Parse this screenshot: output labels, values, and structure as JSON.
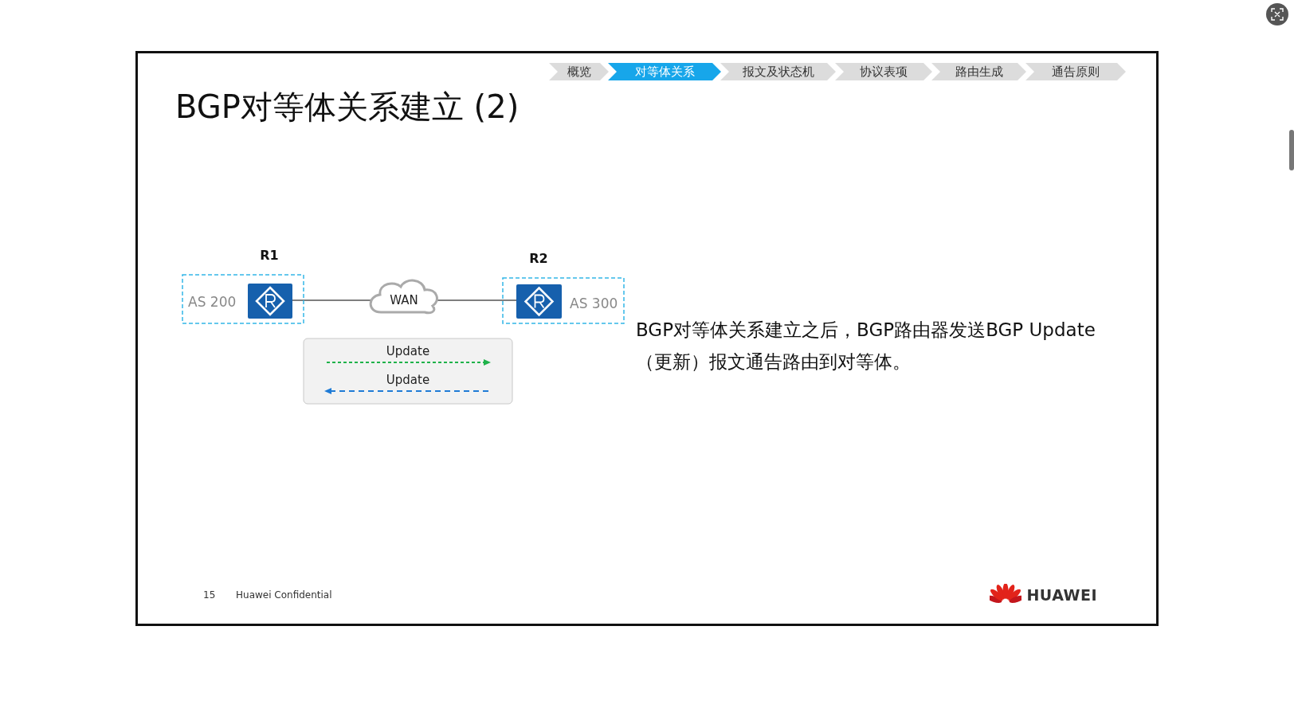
{
  "slide_nav": [
    {
      "label": "概览",
      "selected": false
    },
    {
      "label": "对等体关系",
      "selected": true
    },
    {
      "label": "报文及状态机",
      "selected": false
    },
    {
      "label": "协议表项",
      "selected": false
    },
    {
      "label": "路由生成",
      "selected": false
    },
    {
      "label": "通告原则",
      "selected": false
    }
  ],
  "title": "BGP对等体关系建立 (2)",
  "diagram": {
    "routers": [
      {
        "label": "R1",
        "as": "AS 200"
      },
      {
        "label": "R2",
        "as": "AS 300"
      }
    ],
    "cloud": "WAN",
    "messages": [
      {
        "label": "Update",
        "kind": "rightward",
        "color": "#1fb24a"
      },
      {
        "label": "Update",
        "kind": "leftward",
        "color": "#1f7bd6"
      }
    ]
  },
  "body_text": "BGP对等体关系建立之后，BGP路由器发送BGP Update（更新）报文通告路由到对等体。",
  "footer": {
    "page": "15",
    "confidential": "Huawei Confidential",
    "logo": "HUAWEI"
  }
}
